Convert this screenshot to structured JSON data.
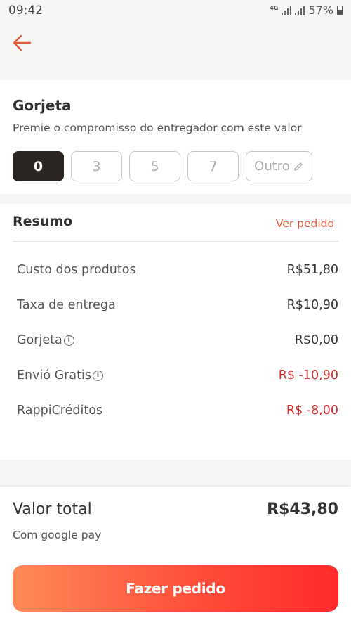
{
  "status_bar": {
    "time": "09:42",
    "network": "4G",
    "battery": "57%"
  },
  "header": {
    "back_icon": "arrow-left-icon",
    "accent": "#e8593c"
  },
  "tip": {
    "title": "Gorjeta",
    "subtitle": "Premie o compromisso do entregador com este valor",
    "options": [
      "0",
      "3",
      "5",
      "7"
    ],
    "selected": "0",
    "other_label": "Outro",
    "other_icon": "pencil-icon"
  },
  "summary": {
    "title": "Resumo",
    "link": "Ver pedido",
    "rows": [
      {
        "label": "Custo dos produtos",
        "value": "R$51,80"
      },
      {
        "label": "Taxa de entrega",
        "value": "R$10,90"
      },
      {
        "label": "Gorjeta",
        "value": "R$0,00"
      },
      {
        "label": "Envió Gratis",
        "value": "R$ -10,90"
      },
      {
        "label": "RappiCréditos",
        "value": "R$ -8,00"
      }
    ]
  },
  "total": {
    "label": "Valor total",
    "value": "R$43,80",
    "payment_method": "Com google pay"
  },
  "cta": {
    "label": "Fazer pedido"
  },
  "colors": {
    "negative": "#d12b2b",
    "selected_tip": "#2b2523",
    "cta_start": "#ff8a57",
    "cta_end": "#ff2a2a"
  }
}
